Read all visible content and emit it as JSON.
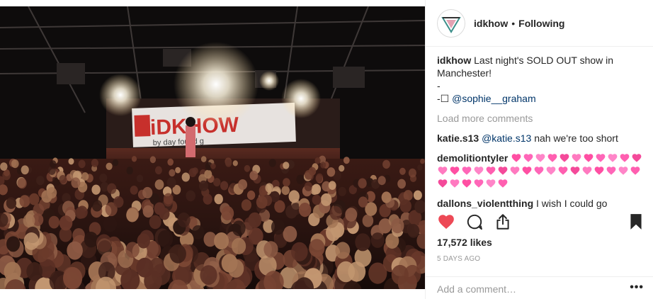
{
  "post": {
    "image_alt": "Concert crowd in front of IDKHOW banner",
    "banner_text": "iDKHOW",
    "banner_subtext": "by day found g"
  },
  "header": {
    "username": "idkhow",
    "separator": "•",
    "follow_status": "Following"
  },
  "caption": {
    "username": "idkhow",
    "text": "Last night's SOLD OUT show in Manchester!",
    "line2": "-",
    "line3_prefix": "-☐",
    "mention": "@sophie__graham"
  },
  "load_more": "Load more comments",
  "comments": [
    {
      "username": "katie.s13",
      "mention": "@katie.s13",
      "text": "nah we're too short"
    },
    {
      "username": "demolitiontyler",
      "emoji_icon": "pink-heart-emoji"
    },
    {
      "username": "dallons_violentthing",
      "text": "I wish I could go"
    }
  ],
  "actions": {
    "like": "heart-icon-filled",
    "comment": "comment-icon",
    "share": "share-icon",
    "save": "bookmark-icon"
  },
  "likes": "17,572 likes",
  "date": "5 DAYS AGO",
  "add_comment": {
    "placeholder": "Add a comment…"
  },
  "more": "•••",
  "colors": {
    "heart": "#ed4956",
    "link": "#003569",
    "muted": "#999999",
    "text": "#262626"
  }
}
